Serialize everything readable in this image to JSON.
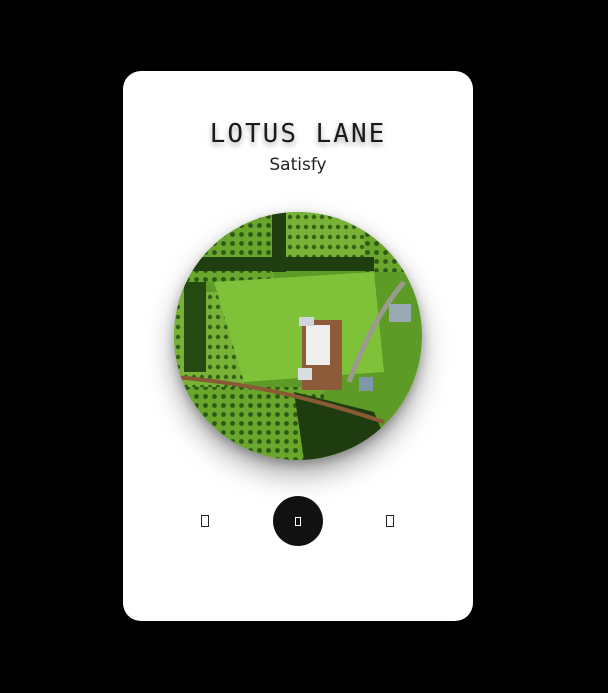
{
  "player": {
    "song_title": "LOTUS LANE",
    "artist": "Satisfy"
  },
  "cover_art": {
    "description_icon": "album-cover-image"
  },
  "controls": {
    "prev_icon": "previous-track-icon",
    "play_icon": "play-icon",
    "next_icon": "next-track-icon"
  },
  "colors": {
    "background": "#000000",
    "card": "#ffffff",
    "play_button": "#111111"
  }
}
